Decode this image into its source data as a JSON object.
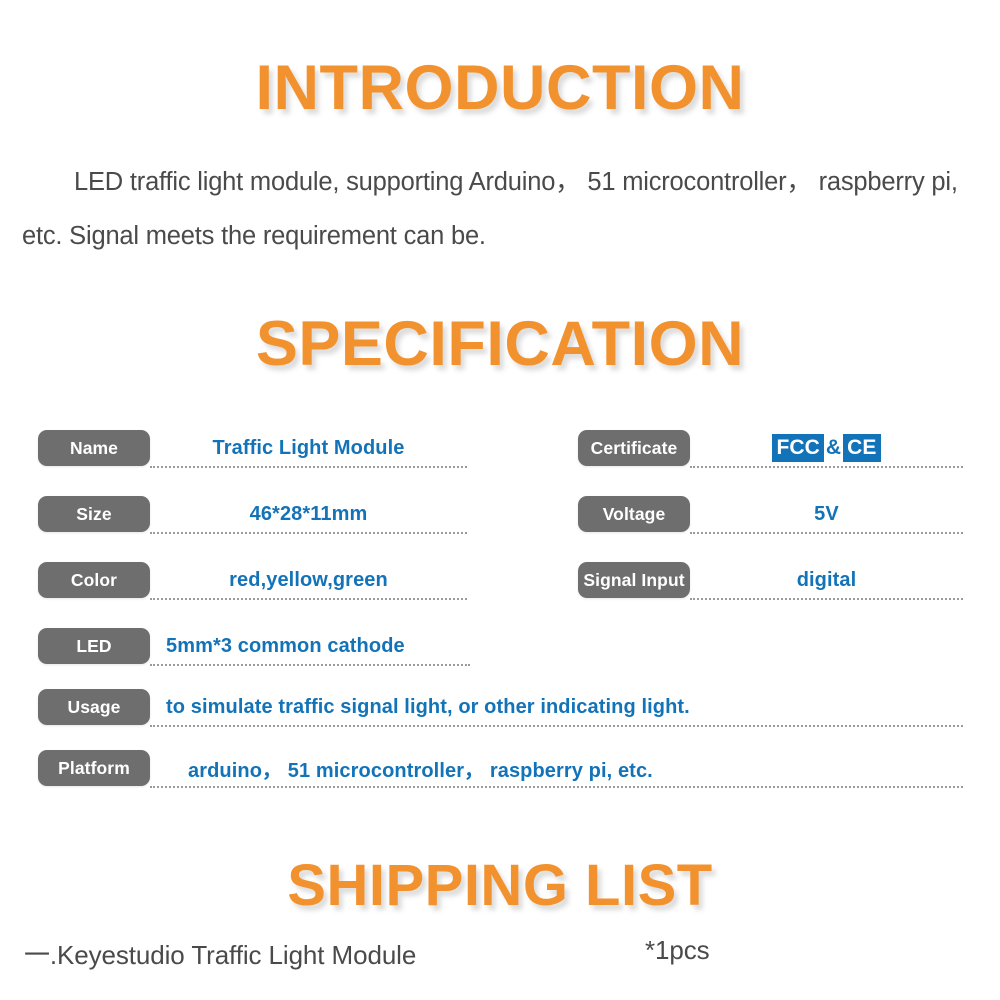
{
  "sections": {
    "introduction_title": "INTRODUCTION",
    "specification_title": "SPECIFICATION",
    "shipping_title": "SHIPPING LIST"
  },
  "introduction": {
    "paragraph": "LED traffic light module, supporting Arduino，  51 microcontroller，  raspberry pi, etc. Signal meets the requirement can be."
  },
  "specification": {
    "left_rows": [
      {
        "label": "Name",
        "value": "Traffic Light Module"
      },
      {
        "label": "Size",
        "value": "46*28*11mm"
      },
      {
        "label": "Color",
        "value": "red,yellow,green"
      },
      {
        "label": "LED",
        "value": "5mm*3 common cathode"
      },
      {
        "label": "Usage",
        "value": "to simulate traffic signal light, or other indicating light."
      },
      {
        "label": "Platform",
        "value": "arduino，  51 microcontroller，  raspberry pi, etc."
      }
    ],
    "right_rows": [
      {
        "label": "Certificate",
        "value": "FCC&CE"
      },
      {
        "label": "Voltage",
        "value": "5V"
      },
      {
        "label": "Signal Input",
        "value": "digital"
      }
    ],
    "certificate_badge": {
      "part1": "FCC",
      "separator": "&",
      "part2": "CE"
    }
  },
  "shipping": {
    "item": "一.Keyestudio Traffic Light Module",
    "quantity": "*1pcs"
  },
  "colors": {
    "heading_orange": "#F2922F",
    "pill_gray": "#6E6E6E",
    "value_blue": "#1373B8",
    "body_text": "#4a4a4a",
    "background": "#ffffff"
  }
}
